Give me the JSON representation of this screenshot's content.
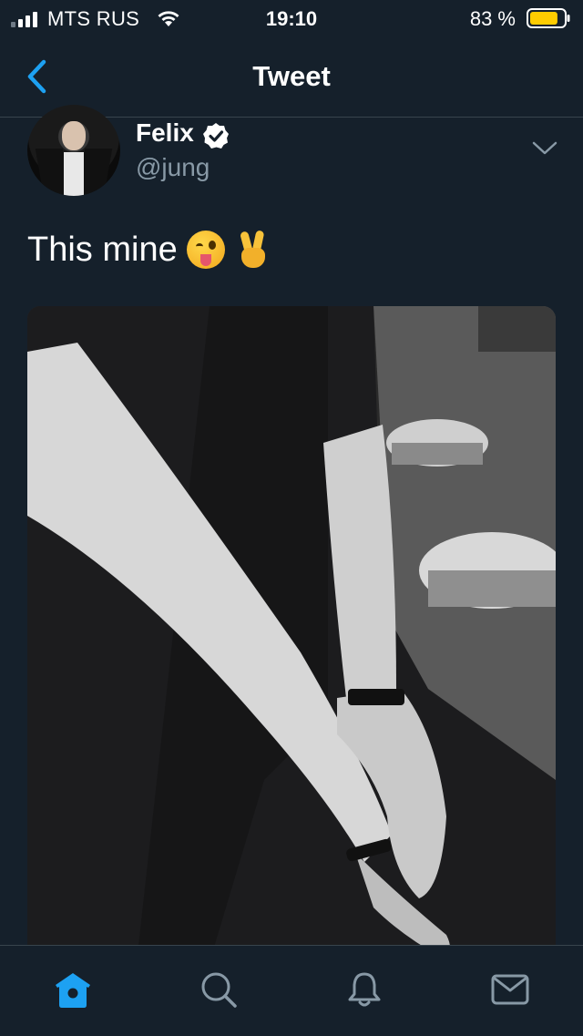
{
  "status_bar": {
    "carrier": "MTS RUS",
    "time": "19:10",
    "battery_percent": "83 %",
    "battery_level": 0.83,
    "signal_bars": 4,
    "signal_bars_filled": 2
  },
  "nav": {
    "title": "Tweet",
    "back_icon": "chevron-left-icon"
  },
  "tweet": {
    "author_name": "Felix",
    "author_handle": "@jung",
    "verified": true,
    "text": "This mine",
    "emojis": [
      "winking-face-with-tongue",
      "victory-hand"
    ]
  },
  "tabbar": {
    "items": [
      {
        "icon": "home-icon",
        "active": true
      },
      {
        "icon": "search-icon",
        "active": false
      },
      {
        "icon": "bell-icon",
        "active": false
      },
      {
        "icon": "mail-icon",
        "active": false
      }
    ]
  },
  "colors": {
    "background": "#15202b",
    "accent": "#1da1f2",
    "secondary_text": "#8899a6",
    "divider": "#38444d",
    "battery": "#ffcc00"
  }
}
